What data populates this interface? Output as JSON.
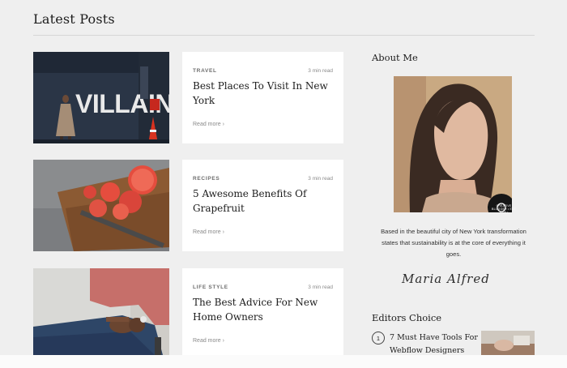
{
  "page": {
    "title": "Latest Posts"
  },
  "posts": [
    {
      "category": "TRAVEL",
      "read_time": "3 min read",
      "title": "Best Places To Visit In New York",
      "more": "Read more ›",
      "image_word": "VILLAIN"
    },
    {
      "category": "RECIPES",
      "read_time": "3 min read",
      "title": "5 Awesome Benefits Of Grapefruit",
      "more": "Read more ›"
    },
    {
      "category": "LIFE STYLE",
      "read_time": "3 min read",
      "title": "The Best Advice For New Home Owners",
      "more": "Read more ›"
    }
  ],
  "about": {
    "heading": "About Me",
    "text": "Based in the beautiful city of New York transformation states that sustainability is at the core of everything it goes.",
    "signature": "Maria Alfred",
    "badge_text": "CREATIVE BLOGGER • EST 2020 •"
  },
  "editors": {
    "heading": "Editors Choice",
    "items": [
      {
        "num": "1",
        "title": "7 Must Have Tools For Webflow Designers"
      }
    ]
  }
}
